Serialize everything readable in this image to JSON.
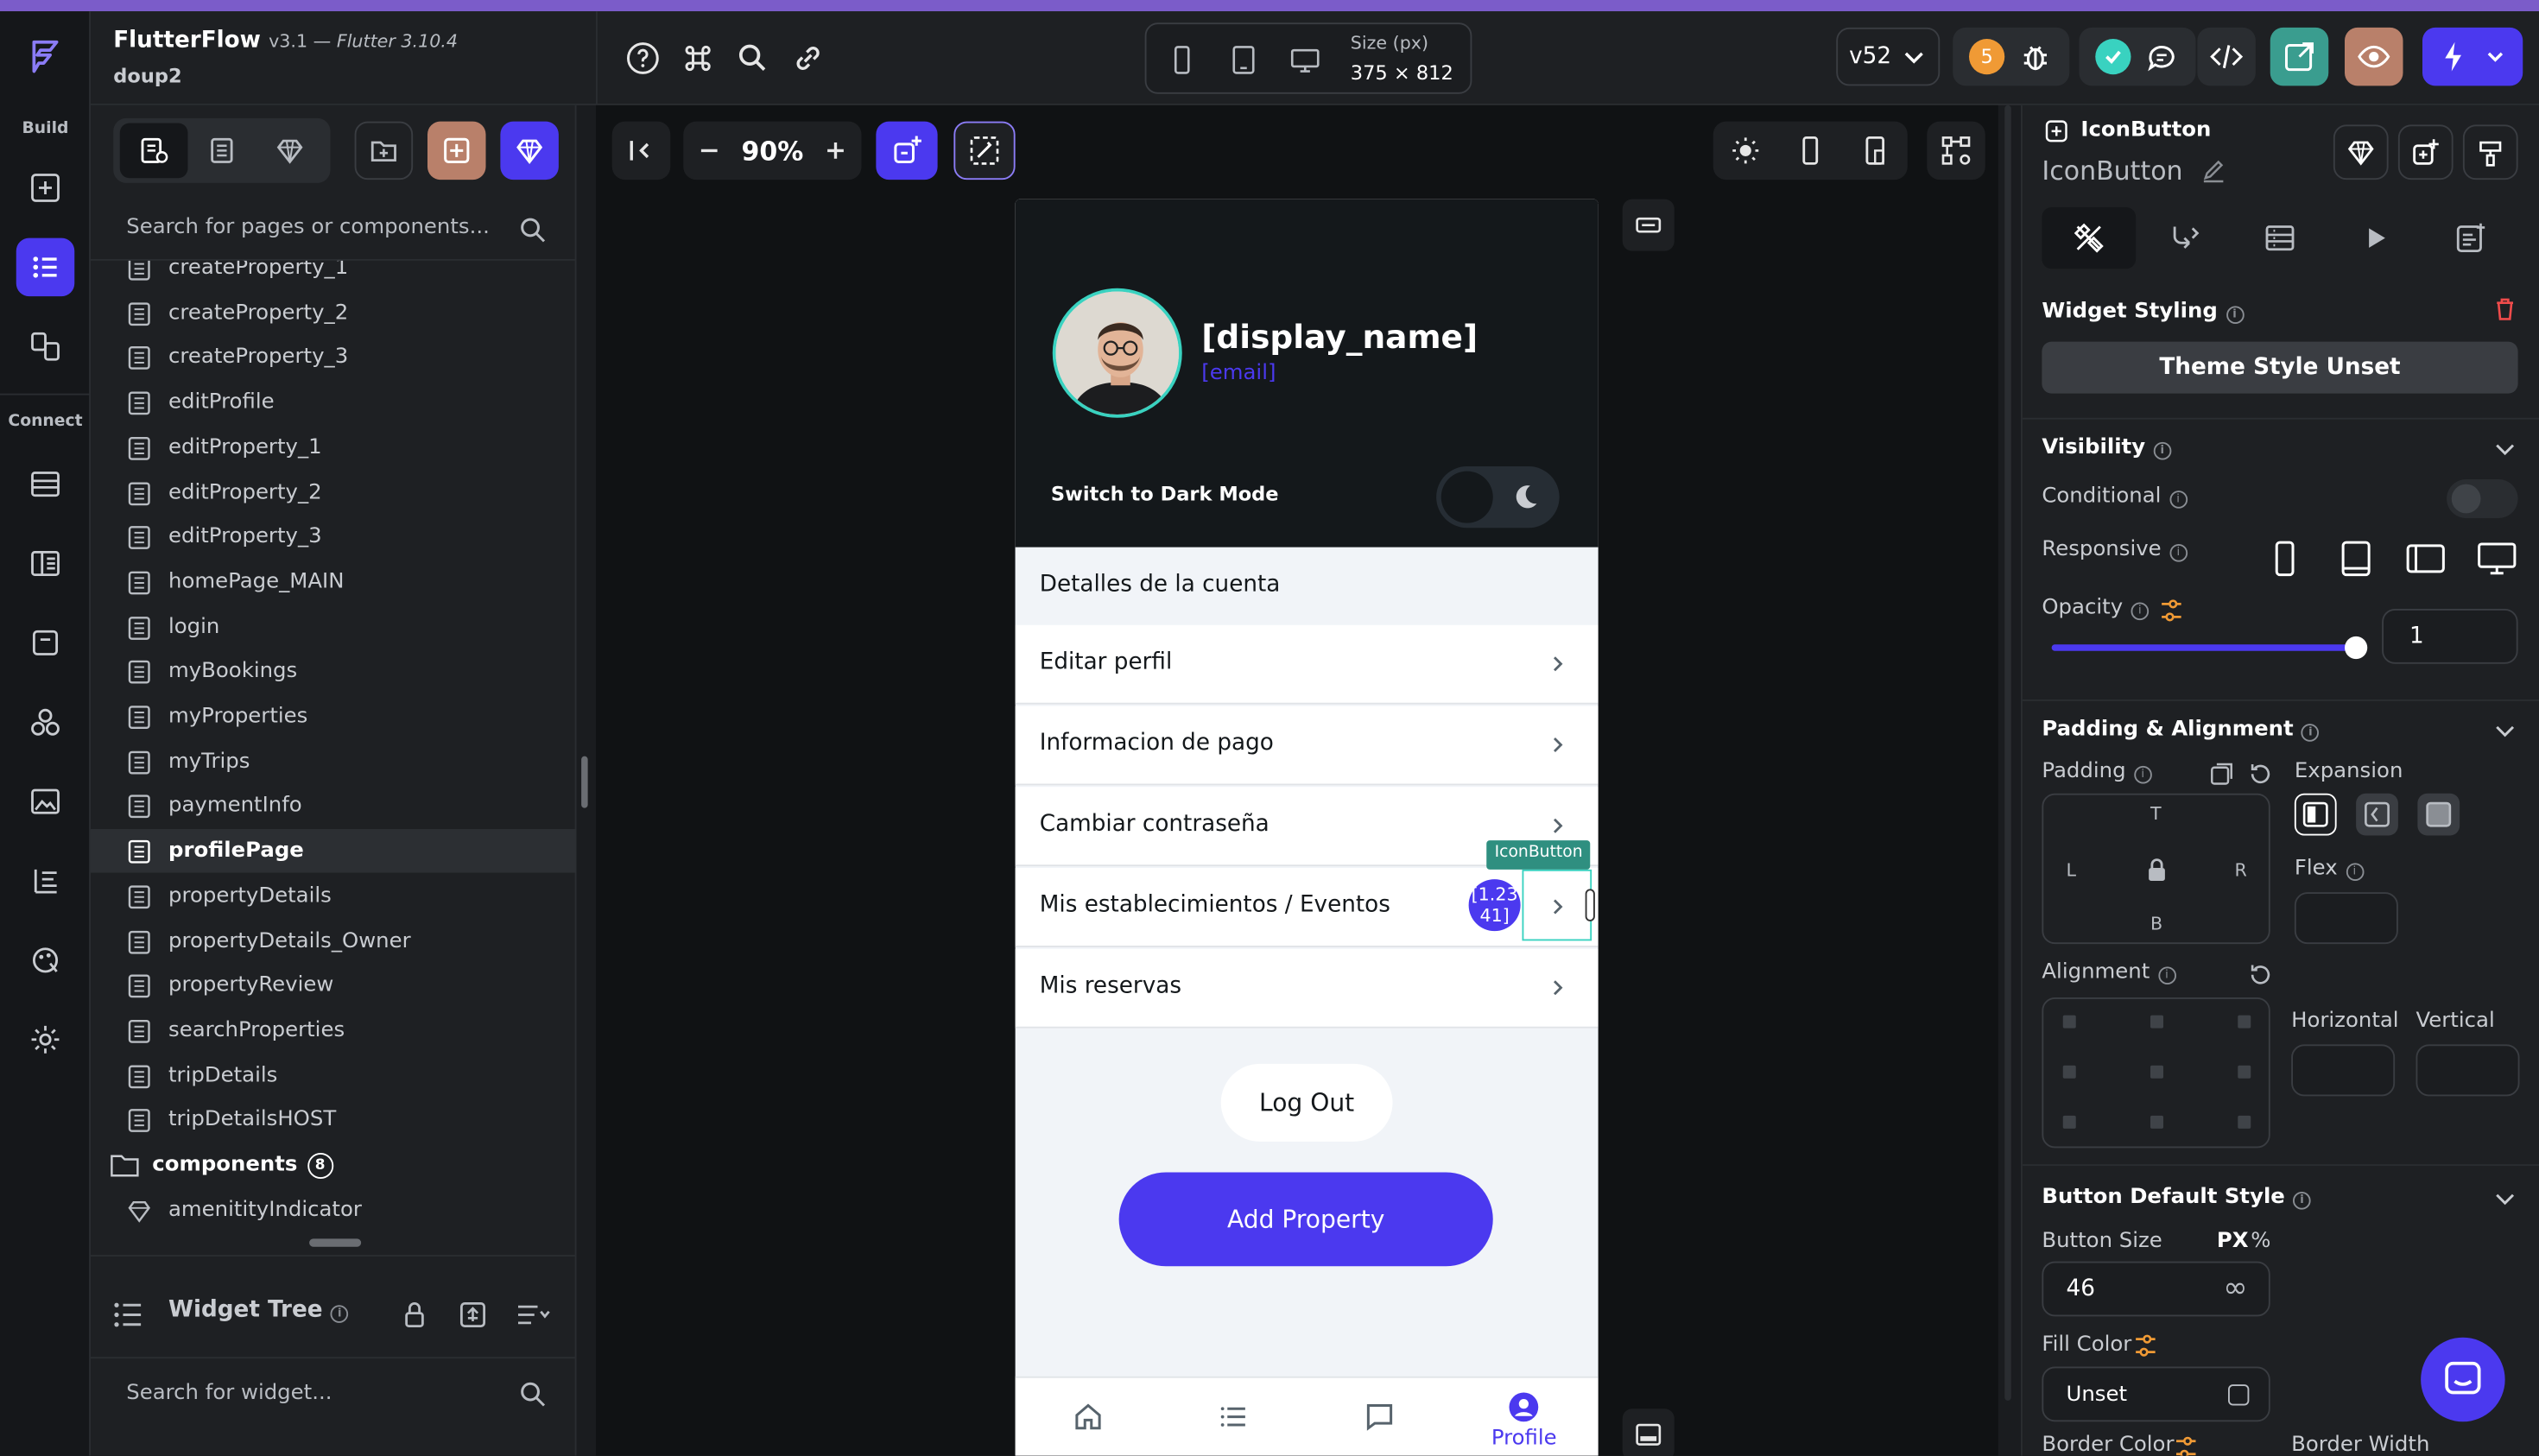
{
  "app": {
    "name": "FlutterFlow",
    "version": "v3.1 —",
    "flutter_version": "Flutter 3.10.4",
    "project": "doup2"
  },
  "rail": {
    "build_label": "Build",
    "connect_label": "Connect"
  },
  "topbar": {
    "size_label": "Size (px)",
    "size_value": "375 × 812",
    "version_select": "v52",
    "notification_count": "5"
  },
  "left_panel": {
    "search_placeholder": "Search for pages or components...",
    "pages": [
      {
        "label": "createProperty_1",
        "active": false
      },
      {
        "label": "createProperty_2",
        "active": false
      },
      {
        "label": "createProperty_3",
        "active": false
      },
      {
        "label": "editProfile",
        "active": false
      },
      {
        "label": "editProperty_1",
        "active": false
      },
      {
        "label": "editProperty_2",
        "active": false
      },
      {
        "label": "editProperty_3",
        "active": false
      },
      {
        "label": "homePage_MAIN",
        "active": false
      },
      {
        "label": "login",
        "active": false
      },
      {
        "label": "myBookings",
        "active": false
      },
      {
        "label": "myProperties",
        "active": false
      },
      {
        "label": "myTrips",
        "active": false
      },
      {
        "label": "paymentInfo",
        "active": false
      },
      {
        "label": "profilePage",
        "active": true
      },
      {
        "label": "propertyDetails",
        "active": false
      },
      {
        "label": "propertyDetails_Owner",
        "active": false
      },
      {
        "label": "propertyReview",
        "active": false
      },
      {
        "label": "searchProperties",
        "active": false
      },
      {
        "label": "tripDetails",
        "active": false
      },
      {
        "label": "tripDetailsHOST",
        "active": false
      }
    ],
    "components_folder": {
      "label": "components",
      "count": "8"
    },
    "components": [
      {
        "label": "amenitityIndicator"
      }
    ],
    "widget_tree_label": "Widget Tree",
    "widget_search_placeholder": "Search for widget..."
  },
  "canvas": {
    "zoom": "90%",
    "selection_tag": "IconButton",
    "coord_badge": "[1.23\n41]"
  },
  "phone": {
    "display_name": "[display_name]",
    "email": "[email]",
    "dark_mode_label": "Switch to Dark Mode",
    "section_header": "Detalles de la cuenta",
    "menu": [
      {
        "label": "Editar perfil"
      },
      {
        "label": "Informacion de pago"
      },
      {
        "label": "Cambiar contraseña"
      },
      {
        "label": "Mis establecimientos / Eventos"
      },
      {
        "label": "Mis reservas"
      }
    ],
    "logout_label": "Log Out",
    "add_property_label": "Add Property",
    "nav_profile_label": "Profile"
  },
  "right_panel": {
    "widget_type": "IconButton",
    "widget_name": "IconButton",
    "widget_styling_label": "Widget Styling",
    "theme_style_button": "Theme Style Unset",
    "visibility_label": "Visibility",
    "conditional_label": "Conditional",
    "responsive_label": "Responsive",
    "opacity_label": "Opacity",
    "opacity_value": "1",
    "padding_alignment_label": "Padding & Alignment",
    "padding_label": "Padding",
    "padding_top": "T",
    "padding_left": "L",
    "padding_right": "R",
    "padding_bottom": "B",
    "expansion_label": "Expansion",
    "flex_label": "Flex",
    "alignment_label": "Alignment",
    "horizontal_label": "Horizontal",
    "vertical_label": "Vertical",
    "button_default_style_label": "Button Default Style",
    "button_size_label": "Button Size",
    "unit_px": "PX",
    "unit_pct": "%",
    "button_size_value": "46",
    "fill_color_label": "Fill Color",
    "fill_color_value": "Unset",
    "border_color_label": "Border Color",
    "border_width_label": "Border Width"
  },
  "colors": {
    "primary": "#4b39ef",
    "accent_teal": "#39d2c0",
    "dark_bg": "#14181b",
    "badge_orange": "#f09a35",
    "check_green": "#39d2c0"
  }
}
